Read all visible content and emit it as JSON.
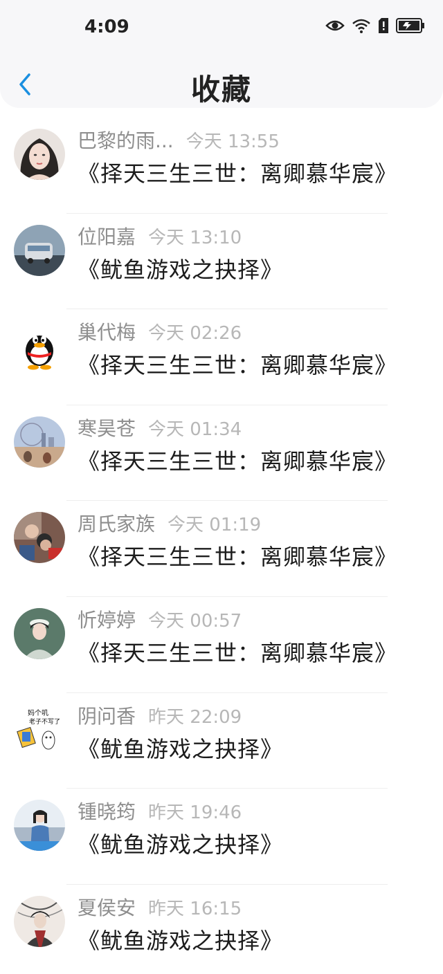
{
  "status_bar": {
    "time": "4:09"
  },
  "header": {
    "title": "收藏"
  },
  "items": [
    {
      "name": "巴黎的雨...",
      "time": "今天 13:55",
      "book": "《择天三生三世：离卿慕华宸》"
    },
    {
      "name": "位阳嘉",
      "time": "今天 13:10",
      "book": "《鱿鱼游戏之抉择》"
    },
    {
      "name": "巢代梅",
      "time": "今天 02:26",
      "book": "《择天三生三世：离卿慕华宸》"
    },
    {
      "name": "寒昊苍",
      "time": "今天 01:34",
      "book": "《择天三生三世：离卿慕华宸》"
    },
    {
      "name": "周氏家族",
      "time": "今天 01:19",
      "book": "《择天三生三世：离卿慕华宸》"
    },
    {
      "name": "忻婷婷",
      "time": "今天 00:57",
      "book": "《择天三生三世：离卿慕华宸》"
    },
    {
      "name": "阴问香",
      "time": "昨天 22:09",
      "book": "《鱿鱼游戏之抉择》",
      "avatar_text_1": "妈个叽",
      "avatar_text_2": "老子不写了"
    },
    {
      "name": "锺晓筠",
      "time": "昨天 19:46",
      "book": "《鱿鱼游戏之抉择》"
    },
    {
      "name": "夏侯安",
      "time": "昨天 16:15",
      "book": "《鱿鱼游戏之抉择》"
    }
  ],
  "colors": {
    "accent": "#1a8fe0",
    "name": "#8e8e8e",
    "time": "#b7b7b7"
  }
}
